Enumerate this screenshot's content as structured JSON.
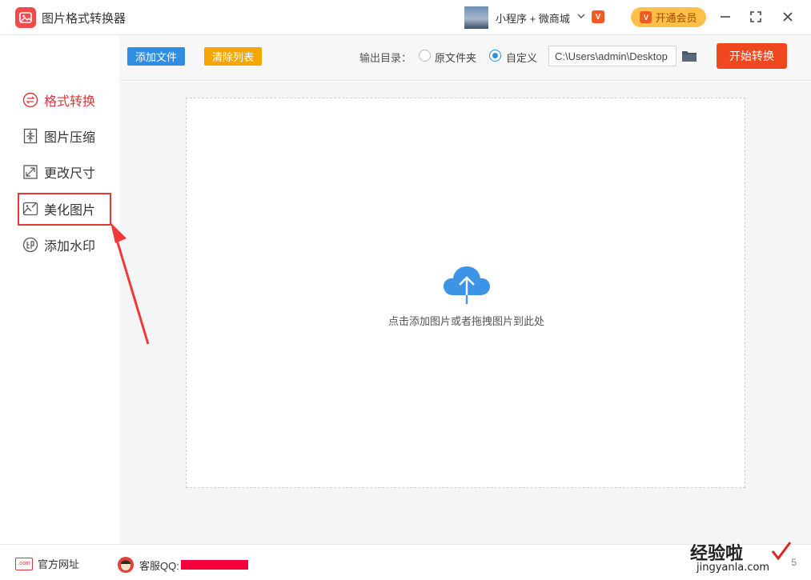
{
  "window": {
    "title": "图片格式转换器",
    "mini_program": "小程序 + 微商城",
    "vip_button": "开通会员",
    "vip_icon_text": "V"
  },
  "sidebar": {
    "items": [
      {
        "label": "格式转换",
        "icon": "format-convert-icon",
        "active": true
      },
      {
        "label": "图片压缩",
        "icon": "compress-icon",
        "active": false
      },
      {
        "label": "更改尺寸",
        "icon": "resize-icon",
        "active": false
      },
      {
        "label": "美化图片",
        "icon": "beautify-icon",
        "active": false
      },
      {
        "label": "添加水印",
        "icon": "watermark-icon",
        "active": false
      }
    ]
  },
  "toolbar": {
    "add_label": "添加文件",
    "clear_label": "清除列表",
    "output_label": "输出目录：",
    "radio_original": "原文件夹",
    "radio_custom": "自定义",
    "path_value": "C:\\Users\\admin\\Desktop",
    "start_label": "开始转换"
  },
  "main": {
    "drop_text": "点击添加图片或者拖拽图片到此处"
  },
  "footer": {
    "website_label": "官方网址",
    "website_icon_text": ".com",
    "qq_label": "客服QQ:",
    "version": "5"
  },
  "watermark": {
    "cn": "经验啦",
    "en": "jingyanla.com"
  },
  "colors": {
    "accent_red": "#e53935",
    "primary_blue": "#2f8de4",
    "orange": "#f7a600",
    "start_red": "#f0481e"
  }
}
